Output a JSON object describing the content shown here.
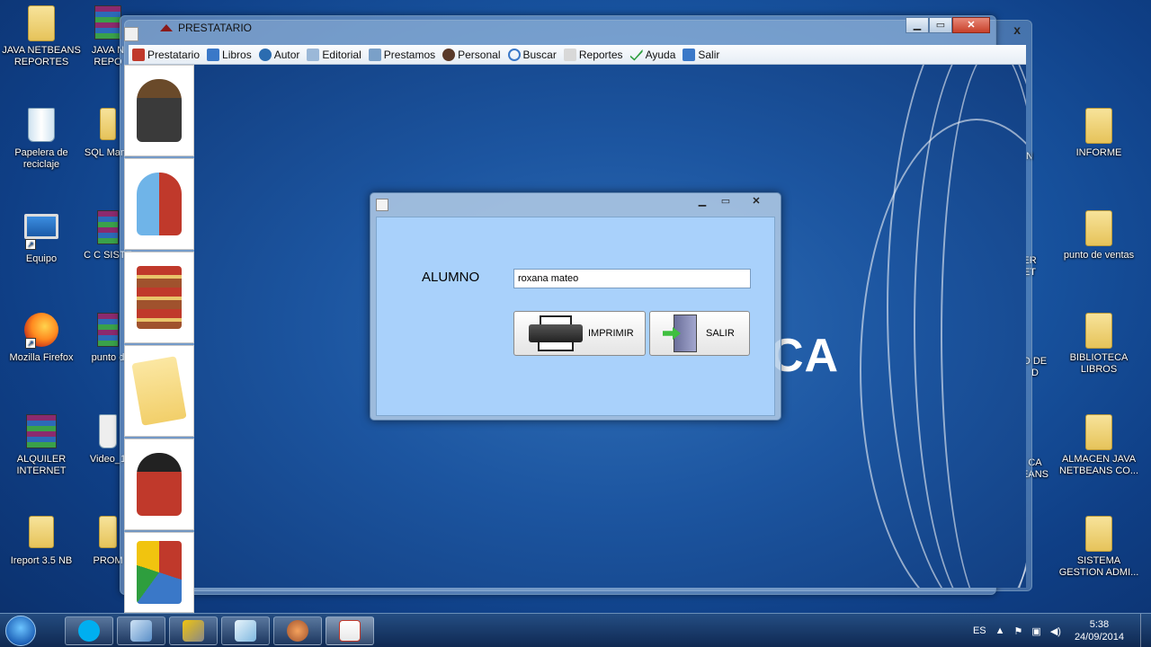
{
  "desktop": {
    "left_icons": [
      {
        "label": "JAVA NETBEANS REPORTES"
      },
      {
        "label": "Papelera de reciclaje"
      },
      {
        "label": "Equipo"
      },
      {
        "label": "Mozilla Firefox"
      },
      {
        "label": "ALQUILER INTERNET"
      },
      {
        "label": "Ireport 3.5 NB"
      }
    ],
    "second_col_icons": [
      {
        "label": "JAVA N REPO"
      },
      {
        "label": "SQL Mana"
      },
      {
        "label": "C C SISTE"
      },
      {
        "label": "punto d"
      },
      {
        "label": "Video_1"
      },
      {
        "label": "PROM"
      }
    ],
    "right_icons": [
      {
        "label": "INFORME"
      },
      {
        "label": "punto de ventas"
      },
      {
        "label": "BIBLIOTECA LIBROS"
      },
      {
        "label": "ALMACEN JAVA NETBEANS CO..."
      },
      {
        "label": "SISTEMA GESTION ADMI..."
      }
    ],
    "partial_right_labels": [
      "N",
      "ER ET",
      "D DE D",
      "CA EANS"
    ]
  },
  "main_window": {
    "title": "PRESTATARIO",
    "menu": [
      {
        "label": "Prestatario",
        "icon": "person-icon"
      },
      {
        "label": "Libros",
        "icon": "edit-icon"
      },
      {
        "label": "Autor",
        "icon": "user-icon"
      },
      {
        "label": "Editorial",
        "icon": "document-icon"
      },
      {
        "label": "Prestamos",
        "icon": "clipboard-icon"
      },
      {
        "label": "Personal",
        "icon": "person-icon"
      },
      {
        "label": "Buscar",
        "icon": "search-icon"
      },
      {
        "label": "Reportes",
        "icon": "report-icon"
      },
      {
        "label": "Ayuda",
        "icon": "check-icon"
      },
      {
        "label": "Salir",
        "icon": "exit-icon"
      }
    ],
    "background_text": "CA"
  },
  "dialog": {
    "field_label": "ALUMNO",
    "field_value": "roxana mateo",
    "print_label": "IMPRIMIR",
    "exit_label": "SALIR"
  },
  "taskbar": {
    "language": "ES",
    "time": "5:38",
    "date": "24/09/2014"
  },
  "colors": {
    "dialog_body": "#a9d1fb",
    "desktop_bg": "#1b5aa8"
  }
}
